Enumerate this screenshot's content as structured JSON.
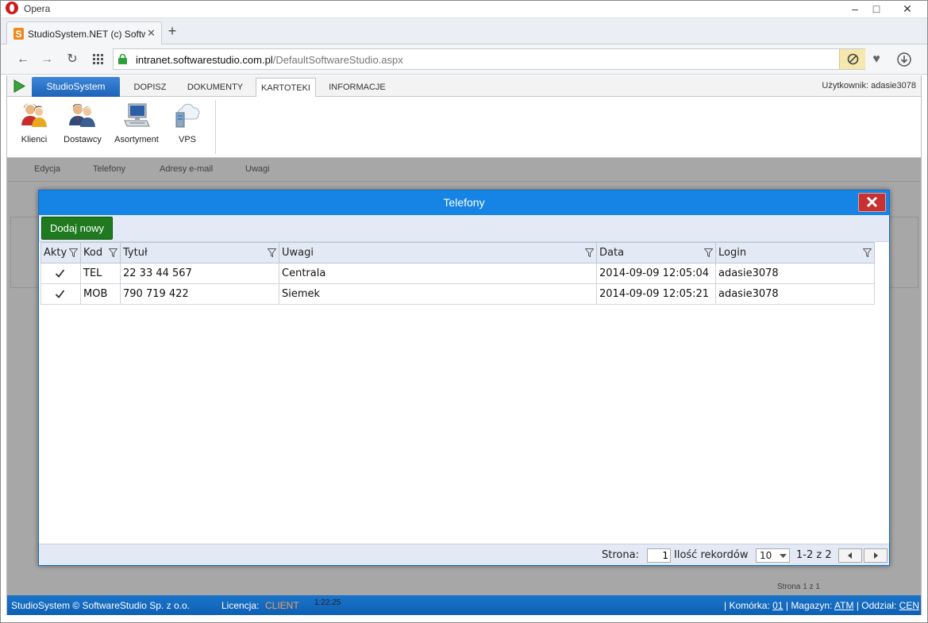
{
  "browser": {
    "window_title": "Opera",
    "tab_title": "StudioSystem.NET (c) Softwa",
    "url_domain": "intranet.softwarestudio.com.pl",
    "url_path": "/DefaultSoftwareStudio.aspx"
  },
  "app": {
    "tabs": [
      {
        "label": "StudioSystem"
      },
      {
        "label": "DOPISZ"
      },
      {
        "label": "DOKUMENTY"
      },
      {
        "label": "KARTOTEKI"
      },
      {
        "label": "INFORMACJE"
      }
    ],
    "user_label": "Użytkownik: adasie3078",
    "ribbon_buttons": [
      {
        "label": "Klienci",
        "icon": "users-icon"
      },
      {
        "label": "Dostawcy",
        "icon": "suppliers-icon"
      },
      {
        "label": "Asortyment",
        "icon": "computer-icon"
      },
      {
        "label": "VPS",
        "icon": "cloud-server-icon"
      }
    ],
    "bg_toolbar": [
      "Edycja",
      "Telefony",
      "Adresy e-mail",
      "Uwagi"
    ],
    "bg_pager": "Strona 1 z 1"
  },
  "modal": {
    "title": "Telefony",
    "add_button": "Dodaj nowy",
    "columns": [
      "Akty",
      "Kod",
      "Tytuł",
      "Uwagi",
      "Data",
      "Login"
    ],
    "rows": [
      {
        "active": true,
        "kod": "TEL",
        "tytul": "22 33 44 567",
        "uwagi": "Centrala",
        "data": "2014-09-09 12:05:04",
        "login": "adasie3078"
      },
      {
        "active": true,
        "kod": "MOB",
        "tytul": "790 719 422",
        "uwagi": "Siemek",
        "data": "2014-09-09 12:05:21",
        "login": "adasie3078"
      }
    ],
    "footer": {
      "page_label": "Strona:",
      "page_value": "1",
      "records_label": "Ilość rekordów",
      "page_size": "10",
      "range": "1-2 z 2"
    }
  },
  "statusbar": {
    "copyright": "StudioSystem © SoftwareStudio Sp. z o.o.",
    "license_label": "Licencja:",
    "license_value": "CLIENT",
    "time": "1:22:25",
    "komorka_label": "Komórka:",
    "komorka_value": "01",
    "magazyn_label": "Magazyn:",
    "magazyn_value": "ATM",
    "oddzial_label": "Oddział:",
    "oddzial_value": "CEN"
  },
  "colors": {
    "accent": "#1584e4",
    "add_button": "#1f7a1f",
    "close_button": "#c63232",
    "statusbar": "#1b74c9",
    "license": "#f1a35f"
  }
}
